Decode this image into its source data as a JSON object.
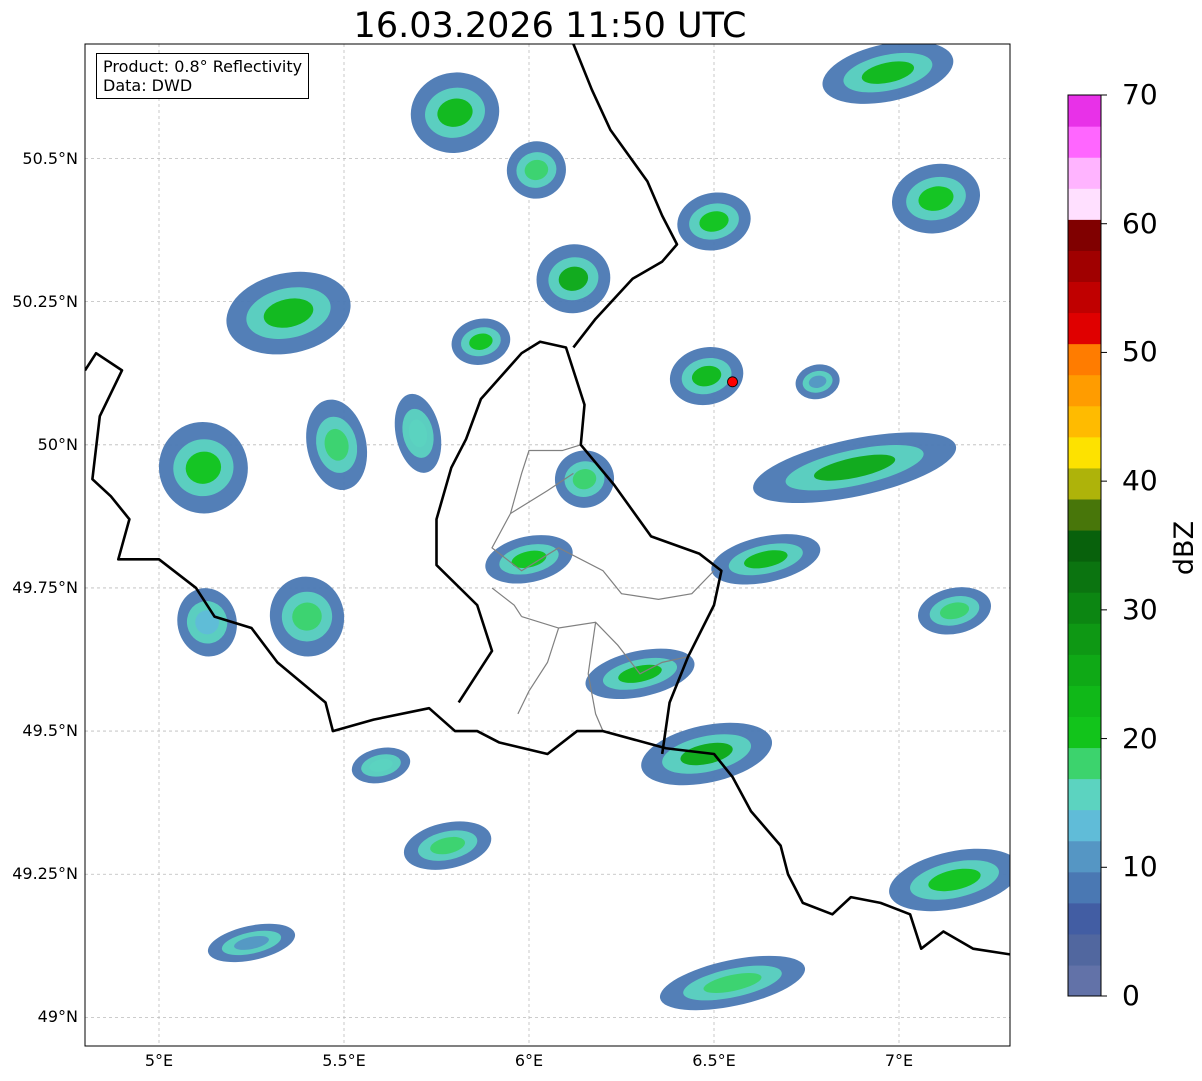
{
  "header": {
    "title": "16.03.2026 11:50 UTC"
  },
  "info_box": {
    "line1": "Product: 0.8° Reflectivity",
    "line2": "Data: DWD"
  },
  "map": {
    "lon_range": [
      4.8,
      7.3
    ],
    "lat_range": [
      48.95,
      50.7
    ],
    "lon_ticks": [
      {
        "value": 5.0,
        "label": "5°E"
      },
      {
        "value": 5.5,
        "label": "5.5°E"
      },
      {
        "value": 6.0,
        "label": "6°E"
      },
      {
        "value": 6.5,
        "label": "6.5°E"
      },
      {
        "value": 7.0,
        "label": "7°E"
      }
    ],
    "lat_ticks": [
      {
        "value": 49.0,
        "label": "49°N"
      },
      {
        "value": 49.25,
        "label": "49.25°N"
      },
      {
        "value": 49.5,
        "label": "49.5°N"
      },
      {
        "value": 49.75,
        "label": "49.75°N"
      },
      {
        "value": 50.0,
        "label": "50°N"
      },
      {
        "value": 50.25,
        "label": "50.25°N"
      },
      {
        "value": 50.5,
        "label": "50.5°N"
      }
    ],
    "radar_site": {
      "lon": 6.55,
      "lat": 50.11,
      "color": "#ff0000"
    },
    "borders": [
      [
        [
          4.8,
          50.13
        ],
        [
          4.83,
          50.16
        ],
        [
          4.9,
          50.13
        ],
        [
          4.84,
          50.05
        ],
        [
          4.82,
          49.94
        ],
        [
          4.87,
          49.91
        ],
        [
          4.92,
          49.87
        ],
        [
          4.89,
          49.8
        ],
        [
          5.0,
          49.8
        ],
        [
          5.1,
          49.75
        ],
        [
          5.15,
          49.7
        ],
        [
          5.25,
          49.68
        ],
        [
          5.32,
          49.62
        ],
        [
          5.45,
          49.55
        ],
        [
          5.47,
          49.5
        ],
        [
          5.58,
          49.52
        ],
        [
          5.73,
          49.54
        ],
        [
          5.8,
          49.5
        ],
        [
          5.86,
          49.5
        ],
        [
          5.92,
          49.48
        ],
        [
          6.05,
          49.46
        ],
        [
          6.13,
          49.5
        ],
        [
          6.2,
          49.5
        ],
        [
          6.37,
          49.47
        ],
        [
          6.5,
          49.46
        ],
        [
          6.55,
          49.42
        ],
        [
          6.6,
          49.36
        ],
        [
          6.68,
          49.3
        ],
        [
          6.7,
          49.25
        ],
        [
          6.74,
          49.2
        ],
        [
          6.82,
          49.18
        ],
        [
          6.87,
          49.21
        ],
        [
          6.95,
          49.2
        ],
        [
          7.03,
          49.18
        ],
        [
          7.06,
          49.12
        ],
        [
          7.12,
          49.15
        ],
        [
          7.2,
          49.12
        ],
        [
          7.3,
          49.11
        ]
      ],
      [
        [
          5.81,
          49.55
        ],
        [
          5.9,
          49.64
        ],
        [
          5.86,
          49.72
        ],
        [
          5.75,
          49.79
        ],
        [
          5.75,
          49.87
        ],
        [
          5.79,
          49.96
        ],
        [
          5.83,
          50.01
        ],
        [
          5.87,
          50.08
        ],
        [
          5.98,
          50.16
        ],
        [
          6.03,
          50.18
        ],
        [
          6.1,
          50.17
        ],
        [
          6.12,
          50.13
        ],
        [
          6.15,
          50.07
        ],
        [
          6.14,
          50.0
        ],
        [
          6.23,
          49.93
        ],
        [
          6.33,
          49.84
        ],
        [
          6.46,
          49.81
        ],
        [
          6.52,
          49.78
        ],
        [
          6.5,
          49.72
        ],
        [
          6.43,
          49.63
        ],
        [
          6.38,
          49.55
        ],
        [
          6.36,
          49.46
        ]
      ],
      [
        [
          6.12,
          50.17
        ],
        [
          6.18,
          50.22
        ],
        [
          6.28,
          50.29
        ],
        [
          6.36,
          50.32
        ],
        [
          6.4,
          50.35
        ],
        [
          6.36,
          50.4
        ],
        [
          6.32,
          50.46
        ],
        [
          6.22,
          50.55
        ],
        [
          6.17,
          50.62
        ],
        [
          6.12,
          50.7
        ]
      ]
    ],
    "cantons": [
      [
        [
          6.12,
          49.95
        ],
        [
          6.05,
          49.92
        ],
        [
          5.95,
          49.88
        ],
        [
          5.9,
          49.82
        ],
        [
          5.98,
          49.78
        ],
        [
          6.08,
          49.82
        ],
        [
          6.2,
          49.78
        ],
        [
          6.25,
          49.74
        ],
        [
          6.35,
          49.73
        ],
        [
          6.44,
          49.74
        ],
        [
          6.5,
          49.78
        ]
      ],
      [
        [
          5.95,
          49.88
        ],
        [
          5.98,
          49.95
        ],
        [
          6.0,
          49.99
        ],
        [
          6.09,
          49.99
        ],
        [
          6.14,
          50.0
        ]
      ],
      [
        [
          5.98,
          49.7
        ],
        [
          6.08,
          49.68
        ],
        [
          6.18,
          49.69
        ],
        [
          6.24,
          49.65
        ],
        [
          6.3,
          49.6
        ],
        [
          6.36,
          49.62
        ],
        [
          6.43,
          49.63
        ]
      ],
      [
        [
          6.08,
          49.68
        ],
        [
          6.05,
          49.62
        ],
        [
          6.0,
          49.57
        ],
        [
          5.97,
          49.53
        ]
      ],
      [
        [
          6.18,
          49.69
        ],
        [
          6.16,
          49.6
        ],
        [
          6.18,
          49.53
        ],
        [
          6.2,
          49.5
        ]
      ],
      [
        [
          5.9,
          49.75
        ],
        [
          5.96,
          49.72
        ],
        [
          5.98,
          49.7
        ]
      ]
    ],
    "echo_clusters": [
      {
        "lon": 5.35,
        "lat": 50.23,
        "rx": 0.17,
        "ry": 0.07,
        "level": 22
      },
      {
        "lon": 5.12,
        "lat": 49.96,
        "rx": 0.12,
        "ry": 0.08,
        "level": 20
      },
      {
        "lon": 5.48,
        "lat": 50.0,
        "rx": 0.08,
        "ry": 0.08,
        "level": 18
      },
      {
        "lon": 5.8,
        "lat": 50.58,
        "rx": 0.12,
        "ry": 0.07,
        "level": 24
      },
      {
        "lon": 6.12,
        "lat": 50.29,
        "rx": 0.1,
        "ry": 0.06,
        "level": 26
      },
      {
        "lon": 5.87,
        "lat": 50.18,
        "rx": 0.08,
        "ry": 0.04,
        "level": 20
      },
      {
        "lon": 6.48,
        "lat": 50.12,
        "rx": 0.1,
        "ry": 0.05,
        "level": 24
      },
      {
        "lon": 6.88,
        "lat": 49.96,
        "rx": 0.28,
        "ry": 0.05,
        "level": 26
      },
      {
        "lon": 6.64,
        "lat": 49.8,
        "rx": 0.15,
        "ry": 0.04,
        "level": 24
      },
      {
        "lon": 6.48,
        "lat": 49.46,
        "rx": 0.18,
        "ry": 0.05,
        "level": 25
      },
      {
        "lon": 6.3,
        "lat": 49.6,
        "rx": 0.15,
        "ry": 0.04,
        "level": 22
      },
      {
        "lon": 7.15,
        "lat": 49.24,
        "rx": 0.18,
        "ry": 0.05,
        "level": 20
      },
      {
        "lon": 6.55,
        "lat": 49.06,
        "rx": 0.2,
        "ry": 0.04,
        "level": 17
      },
      {
        "lon": 6.0,
        "lat": 49.8,
        "rx": 0.12,
        "ry": 0.04,
        "level": 20
      },
      {
        "lon": 5.78,
        "lat": 49.3,
        "rx": 0.12,
        "ry": 0.04,
        "level": 17
      },
      {
        "lon": 5.4,
        "lat": 49.7,
        "rx": 0.1,
        "ry": 0.07,
        "level": 18
      },
      {
        "lon": 5.13,
        "lat": 49.69,
        "rx": 0.08,
        "ry": 0.06,
        "level": 14
      },
      {
        "lon": 6.97,
        "lat": 50.65,
        "rx": 0.18,
        "ry": 0.05,
        "level": 22
      },
      {
        "lon": 6.5,
        "lat": 50.39,
        "rx": 0.1,
        "ry": 0.05,
        "level": 20
      },
      {
        "lon": 7.1,
        "lat": 50.43,
        "rx": 0.12,
        "ry": 0.06,
        "level": 20
      },
      {
        "lon": 5.6,
        "lat": 49.44,
        "rx": 0.08,
        "ry": 0.03,
        "level": 15
      },
      {
        "lon": 5.25,
        "lat": 49.13,
        "rx": 0.12,
        "ry": 0.03,
        "level": 12
      },
      {
        "lon": 7.15,
        "lat": 49.71,
        "rx": 0.1,
        "ry": 0.04,
        "level": 18
      },
      {
        "lon": 6.02,
        "lat": 50.48,
        "rx": 0.08,
        "ry": 0.05,
        "level": 18
      },
      {
        "lon": 6.78,
        "lat": 50.11,
        "rx": 0.06,
        "ry": 0.03,
        "level": 12
      },
      {
        "lon": 5.7,
        "lat": 50.02,
        "rx": 0.06,
        "ry": 0.07,
        "level": 16
      },
      {
        "lon": 6.15,
        "lat": 49.94,
        "rx": 0.08,
        "ry": 0.05,
        "level": 18
      }
    ]
  },
  "colorbar": {
    "label": "dBZ",
    "min": 0,
    "max": 70,
    "ticks": [
      {
        "value": 0,
        "label": "0"
      },
      {
        "value": 10,
        "label": "10"
      },
      {
        "value": 20,
        "label": "20"
      },
      {
        "value": 30,
        "label": "30"
      },
      {
        "value": 40,
        "label": "40"
      },
      {
        "value": 50,
        "label": "50"
      },
      {
        "value": 60,
        "label": "60"
      },
      {
        "value": 70,
        "label": "70"
      }
    ],
    "colors": [
      "#6272a8",
      "#51679f",
      "#425da3",
      "#4a78b3",
      "#5596c4",
      "#60bcd8",
      "#5cd3c0",
      "#3cd36d",
      "#12c41b",
      "#10b818",
      "#0fa916",
      "#0e9814",
      "#0c8612",
      "#0b7410",
      "#08610c",
      "#48760a",
      "#aeb30a",
      "#fde200",
      "#ffbb00",
      "#ff9c00",
      "#ff7c00",
      "#e00000",
      "#c00000",
      "#a00000",
      "#800000",
      "#ffe0ff",
      "#ffb4ff",
      "#ff66ff",
      "#e831e8"
    ]
  }
}
